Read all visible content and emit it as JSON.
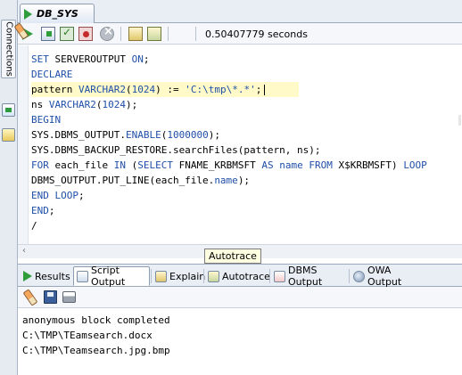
{
  "connections_panel": {
    "tab_label": "Connections"
  },
  "document_tab": {
    "title": "DB_SYS"
  },
  "toolbar": {
    "elapsed_time": "0.50407779 seconds"
  },
  "editor": {
    "lines": [
      [
        {
          "t": "SET",
          "k": "kw"
        },
        {
          "t": " SERVEROUTPUT "
        },
        {
          "t": "ON",
          "k": "kw"
        },
        {
          "t": ";"
        }
      ],
      [
        {
          "t": "DECLARE",
          "k": "kw"
        }
      ],
      [
        {
          "t": "pattern "
        },
        {
          "t": "VARCHAR2",
          "k": "kw"
        },
        {
          "t": "("
        },
        {
          "t": "1024",
          "k": "num"
        },
        {
          "t": ") := "
        },
        {
          "t": "'C:\\tmp\\*.*'",
          "k": "str"
        },
        {
          "t": ";"
        }
      ],
      [
        {
          "t": "ns "
        },
        {
          "t": "VARCHAR2",
          "k": "kw"
        },
        {
          "t": "("
        },
        {
          "t": "1024",
          "k": "num"
        },
        {
          "t": ");"
        }
      ],
      [
        {
          "t": "BEGIN",
          "k": "kw"
        }
      ],
      [
        {
          "t": "SYS.DBMS_OUTPUT."
        },
        {
          "t": "ENABLE",
          "k": "kw"
        },
        {
          "t": "("
        },
        {
          "t": "1000000",
          "k": "num"
        },
        {
          "t": ");"
        }
      ],
      [
        {
          "t": "SYS.DBMS_BACKUP_RESTORE.searchFiles(pattern, ns);"
        }
      ],
      [
        {
          "t": "FOR",
          "k": "kw"
        },
        {
          "t": " each_file "
        },
        {
          "t": "IN",
          "k": "kw"
        },
        {
          "t": " ("
        },
        {
          "t": "SELECT",
          "k": "kw"
        },
        {
          "t": " FNAME_KRBMSFT "
        },
        {
          "t": "AS",
          "k": "kw"
        },
        {
          "t": " "
        },
        {
          "t": "name",
          "k": "kw"
        },
        {
          "t": " "
        },
        {
          "t": "FROM",
          "k": "kw"
        },
        {
          "t": " X$KRBMSFT) "
        },
        {
          "t": "LOOP",
          "k": "kw"
        }
      ],
      [
        {
          "t": "DBMS_OUTPUT.PUT_LINE(each_file."
        },
        {
          "t": "name",
          "k": "kw"
        },
        {
          "t": ");"
        }
      ],
      [
        {
          "t": "END",
          "k": "kw"
        },
        {
          "t": " "
        },
        {
          "t": "LOOP",
          "k": "kw"
        },
        {
          "t": ";"
        }
      ],
      [
        {
          "t": "END",
          "k": "kw"
        },
        {
          "t": ";"
        }
      ],
      [
        {
          "t": "/"
        }
      ]
    ]
  },
  "tooltip": {
    "text": "Autotrace"
  },
  "output_tabs": {
    "results": "Results",
    "script_output": "Script Output",
    "explain": "Explain",
    "autotrace": "Autotrace",
    "dbms_output": "DBMS Output",
    "owa_output": "OWA Output"
  },
  "output": {
    "lines": [
      "anonymous block completed",
      "C:\\TMP\\TEamsearch.docx",
      "C:\\TMP\\Teamsearch.jpg.bmp"
    ]
  },
  "colors": {
    "keyword": "#1f4fa8",
    "current_line": "#fffac8",
    "run_green": "#2f9e3a"
  }
}
